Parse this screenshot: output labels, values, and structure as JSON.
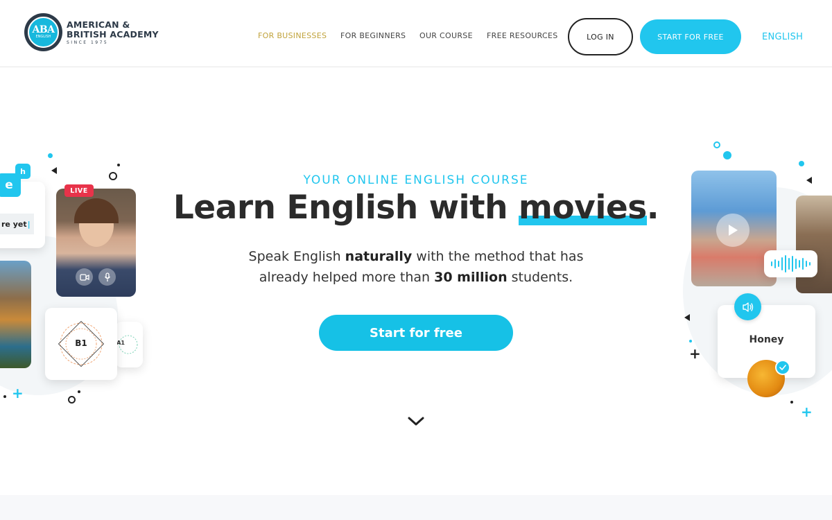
{
  "brand": {
    "logo_mark": "ABA",
    "logo_sub": "ENGLISH",
    "name_line1": "AMERICAN &",
    "name_line2": "BRITISH ACADEMY",
    "since": "SINCE 1975"
  },
  "nav": {
    "items": [
      "FOR BUSINESSES",
      "FOR BEGINNERS",
      "OUR COURSE",
      "FREE RESOURCES"
    ],
    "login": "LOG IN",
    "start": "START FOR FREE",
    "language": "ENGLISH"
  },
  "hero": {
    "eyebrow": "YOUR ONLINE ENGLISH COURSE",
    "headline_pre": "Learn English with ",
    "headline_highlight": "movies",
    "headline_post": ".",
    "sub_1": "Speak English ",
    "sub_bold_1": "naturally",
    "sub_2": " with the method that has",
    "sub_3": "already helped more than ",
    "sub_bold_2": "30 million",
    "sub_4": " students.",
    "cta": "Start for free"
  },
  "decor_left": {
    "live_badge": "LIVE",
    "chip_e": "e",
    "chip_h": "h",
    "typing_text": "re yet",
    "level_main": "B1",
    "level_small": "A1"
  },
  "decor_right": {
    "word_card": "Honey"
  },
  "colors": {
    "accent": "#21c6ee",
    "nav_active": "#c0a23a",
    "text_dark": "#2b2b2b",
    "live_red": "#e8334a"
  },
  "icons": [
    "chevron-down-icon",
    "video-camera-icon",
    "microphone-icon",
    "speaker-icon",
    "play-icon",
    "audio-wave-icon",
    "check-icon"
  ]
}
